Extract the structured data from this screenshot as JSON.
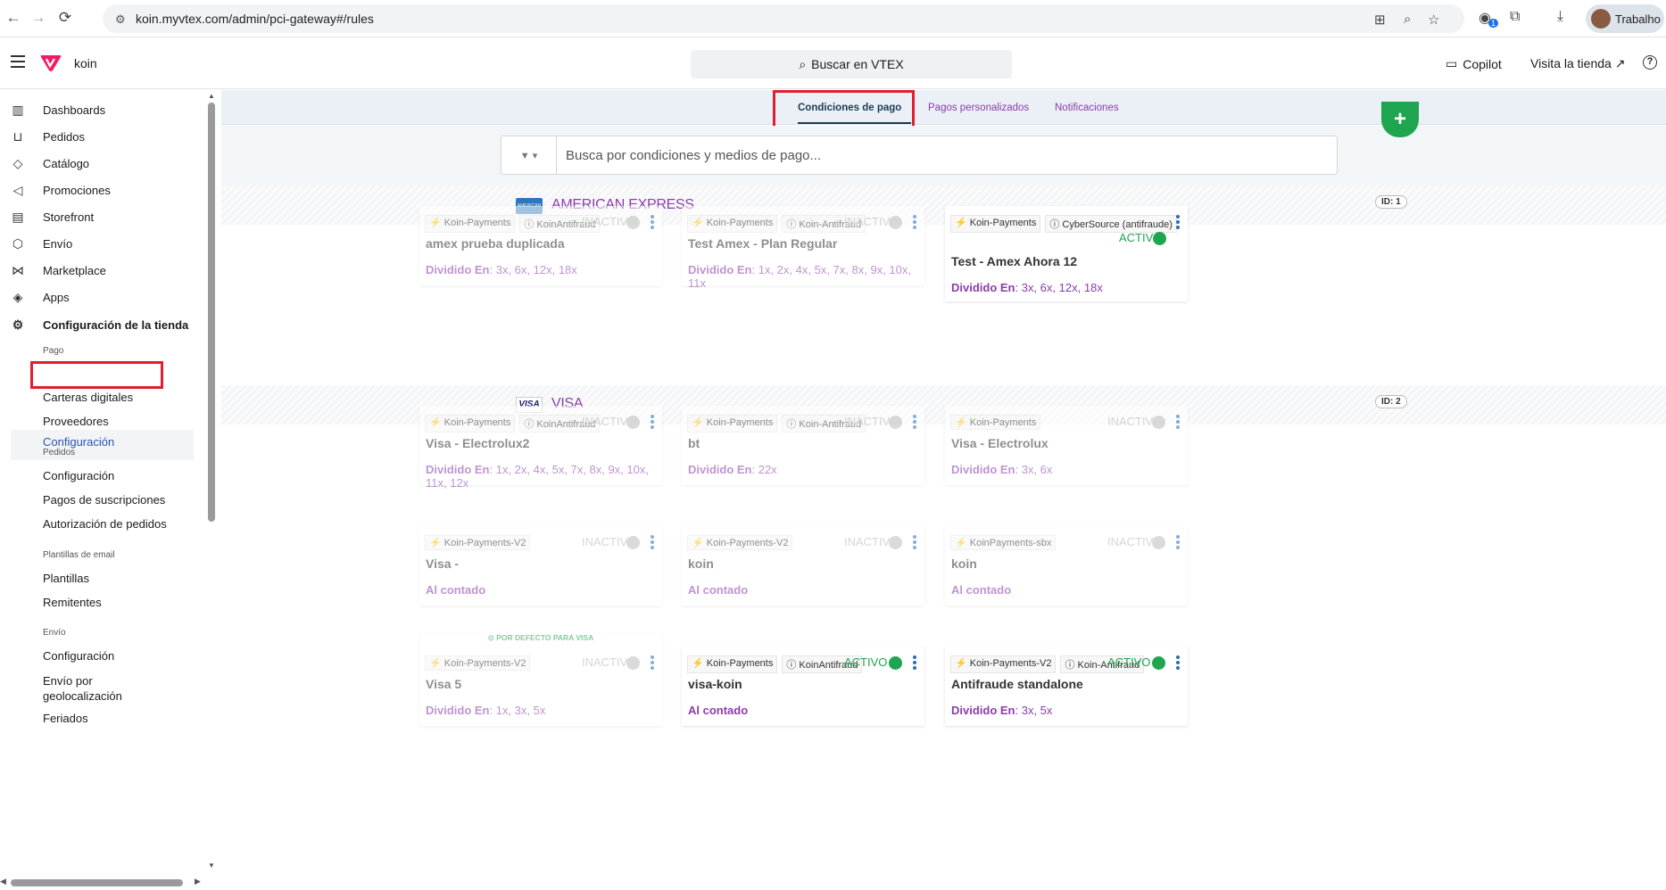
{
  "browser": {
    "url": "koin.myvtex.com/admin/pci-gateway#/rules",
    "profile_name": "Trabalho",
    "extension_badge": "1"
  },
  "header": {
    "store_name": "koin",
    "search_label": "Buscar en VTEX",
    "copilot_label": "Copilot",
    "visit_store_label": "Visita la tienda ↗",
    "help_label": "?"
  },
  "sidebar": {
    "items": [
      {
        "label": "Dashboards",
        "icon": "bar-chart-icon"
      },
      {
        "label": "Pedidos",
        "icon": "cart-icon"
      },
      {
        "label": "Catálogo",
        "icon": "tag-icon"
      },
      {
        "label": "Promociones",
        "icon": "megaphone-icon"
      },
      {
        "label": "Storefront",
        "icon": "layout-icon"
      },
      {
        "label": "Envío",
        "icon": "box-icon"
      },
      {
        "label": "Marketplace",
        "icon": "share-icon"
      },
      {
        "label": "Apps",
        "icon": "layers-icon"
      },
      {
        "label": "Configuración de la tienda",
        "icon": "gear-icon"
      }
    ],
    "sections": [
      {
        "title": "Pago",
        "items": [
          "Configuración",
          "Carteras digitales",
          "Proveedores"
        ]
      },
      {
        "title": "Pedidos",
        "items": [
          "Configuración",
          "Pagos de suscripciones",
          "Autorización de pedidos"
        ]
      },
      {
        "title": "Plantillas de email",
        "items": [
          "Plantillas",
          "Remitentes"
        ]
      },
      {
        "title": "Envío",
        "items": [
          "Configuración",
          "Envío por geolocalización",
          "Feriados"
        ]
      }
    ]
  },
  "tabs": [
    "Condiciones de pago",
    "Pagos personalizados",
    "Notificaciones"
  ],
  "filter": {
    "placeholder": "Busca por condiciones y medios de pago...",
    "add_label": "+"
  },
  "brands": [
    {
      "name": "AMERICAN EXPRESS",
      "id": "ID: 1",
      "logo_text": "AMERICAN EXPRESS"
    },
    {
      "name": "VISA",
      "id": "ID: 2",
      "logo_text": "VISA"
    }
  ],
  "cards": [
    {
      "connector": "Koin-Payments",
      "antifraud": "KoinAntifraud",
      "status": "INACTIVO",
      "active": false,
      "name": "amex prueba duplicada",
      "inst_label": "Dividido En",
      "inst_value": ": 3x, 6x, 12x, 18x"
    },
    {
      "connector": "Koin-Payments",
      "antifraud": "Koin-Antifraud",
      "status": "INACTIVO",
      "active": false,
      "name": "Test Amex - Plan Regular",
      "inst_label": "Dividido En",
      "inst_value": ": 1x, 2x, 4x, 5x, 7x, 8x, 9x, 10x, 11x"
    },
    {
      "connector": "Koin-Payments",
      "antifraud": "CyberSource (antifraude)",
      "status": "ACTIVO",
      "active": true,
      "name": "Test - Amex Ahora 12",
      "inst_label": "Dividido En",
      "inst_value": ": 3x, 6x, 12x, 18x"
    },
    {
      "connector": "Koin-Payments",
      "antifraud": "KoinAntifraud",
      "status": "INACTIVO",
      "active": false,
      "name": "Visa - Electrolux2",
      "inst_label": "Dividido En",
      "inst_value": ": 1x, 2x, 4x, 5x, 7x, 8x, 9x, 10x, 11x, 12x"
    },
    {
      "connector": "Koin-Payments",
      "antifraud": "Koin-Antifraud",
      "status": "INACTIVO",
      "active": false,
      "name": "bt",
      "inst_label": "Dividido En",
      "inst_value": ": 22x"
    },
    {
      "connector": "Koin-Payments",
      "antifraud": "",
      "status": "INACTIVO",
      "active": false,
      "name": "Visa - Electrolux",
      "inst_label": "Dividido En",
      "inst_value": ": 3x, 6x"
    },
    {
      "connector": "Koin-Payments-V2",
      "antifraud": "",
      "status": "INACTIVO",
      "active": false,
      "name": "Visa -",
      "inst_label": "Al contado",
      "inst_value": ""
    },
    {
      "connector": "Koin-Payments-V2",
      "antifraud": "",
      "status": "INACTIVO",
      "active": false,
      "name": "koin",
      "inst_label": "Al contado",
      "inst_value": ""
    },
    {
      "connector": "KoinPayments-sbx",
      "antifraud": "",
      "status": "INACTIVO",
      "active": false,
      "name": "koin",
      "inst_label": "Al contado",
      "inst_value": ""
    },
    {
      "connector": "Koin-Payments-V2",
      "antifraud": "",
      "status": "INACTIVO",
      "active": false,
      "name": "Visa 5",
      "inst_label": "Dividido En",
      "inst_value": ": 1x, 3x, 5x",
      "default_label": "⊙ POR DEFECTO PARA VISA"
    },
    {
      "connector": "Koin-Payments",
      "antifraud": "KoinAntifraud",
      "status": "ACTIVO",
      "active": true,
      "name": "visa-koin",
      "inst_label": "Al contado",
      "inst_value": ""
    },
    {
      "connector": "Koin-Payments-V2",
      "antifraud": "Koin-Antifraud",
      "status": "ACTIVO",
      "active": true,
      "name": "Antifraude standalone",
      "inst_label": "Dividido En",
      "inst_value": ": 3x, 5x"
    }
  ],
  "colors": {
    "accent_purple": "#8b3dac",
    "active_green": "#1fa550",
    "highlight_red": "#e11d2f"
  }
}
